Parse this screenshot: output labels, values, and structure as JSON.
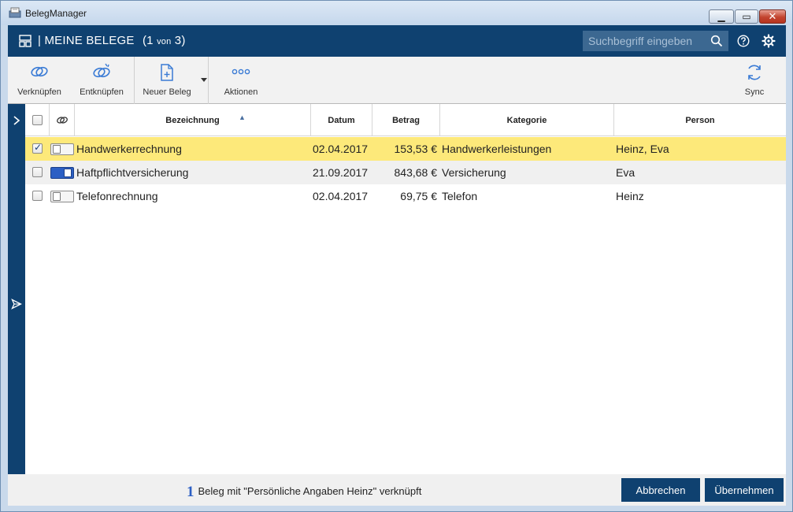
{
  "window": {
    "title": "BelegManager",
    "controls": {
      "minimize": "▁",
      "maximize": "▭",
      "close": "✕"
    }
  },
  "header": {
    "title": "| MEINE BELEGE",
    "count_current": "(1",
    "count_of": "von",
    "count_total": "3)",
    "search_placeholder": "Suchbegriff eingeben",
    "icons": [
      "grid-icon",
      "search-icon",
      "help-icon",
      "gear-icon"
    ]
  },
  "toolbar": {
    "verknuepfen": "Verknüpfen",
    "entknuepfen": "Entknüpfen",
    "neuer_beleg": "Neuer Beleg",
    "aktionen": "Aktionen",
    "sync": "Sync"
  },
  "table": {
    "columns": {
      "bezeichnung": "Bezeichnung",
      "datum": "Datum",
      "betrag": "Betrag",
      "kategorie": "Kategorie",
      "person": "Person"
    },
    "rows": [
      {
        "checked": true,
        "linked": false,
        "bezeichnung": "Handwerkerrechnung",
        "datum": "02.04.2017",
        "betrag": "153,53 €",
        "kategorie": "Handwerkerleistungen",
        "person": "Heinz, Eva"
      },
      {
        "checked": false,
        "linked": true,
        "bezeichnung": "Haftpflichtversicherung",
        "datum": "21.09.2017",
        "betrag": "843,68 €",
        "kategorie": "Versicherung",
        "person": "Eva"
      },
      {
        "checked": false,
        "linked": false,
        "bezeichnung": "Telefonrechnung",
        "datum": "02.04.2017",
        "betrag": "69,75 €",
        "kategorie": "Telefon",
        "person": "Heinz"
      }
    ]
  },
  "footer": {
    "count": "1",
    "message": "Beleg mit \"Persönliche Angaben Heinz\" verknüpft",
    "cancel": "Abbrechen",
    "apply": "Übernehmen"
  },
  "colors": {
    "primary": "#0f4170",
    "selected_row": "#fde97a",
    "toggle_on": "#2c5fc4"
  }
}
